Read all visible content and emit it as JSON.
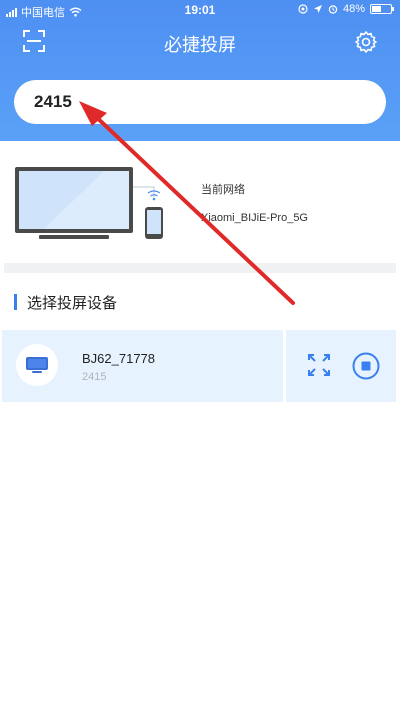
{
  "status_bar": {
    "carrier": "中国电信",
    "time": "19:01",
    "battery": "48%",
    "battery_level": 0.48,
    "icons": [
      "signal-icon",
      "wifi-icon",
      "location-icon",
      "alarm-icon",
      "battery-icon"
    ]
  },
  "header": {
    "title": "必捷投屏",
    "left_icon": "scan-icon",
    "right_icon": "gear-icon",
    "accent_color": "#4e8ff2"
  },
  "search": {
    "value": "2415"
  },
  "network": {
    "label": "当前网络",
    "name": "Xiaomi_BIJiE-Pro_5G"
  },
  "section": {
    "title": "选择投屏设备"
  },
  "devices": [
    {
      "name": "BJ62_71778",
      "code": "2415",
      "icon": "tv-icon",
      "actions": [
        "fullscreen-icon",
        "stop-icon"
      ]
    }
  ],
  "annotation": {
    "type": "arrow",
    "color": "#e02a2a"
  }
}
